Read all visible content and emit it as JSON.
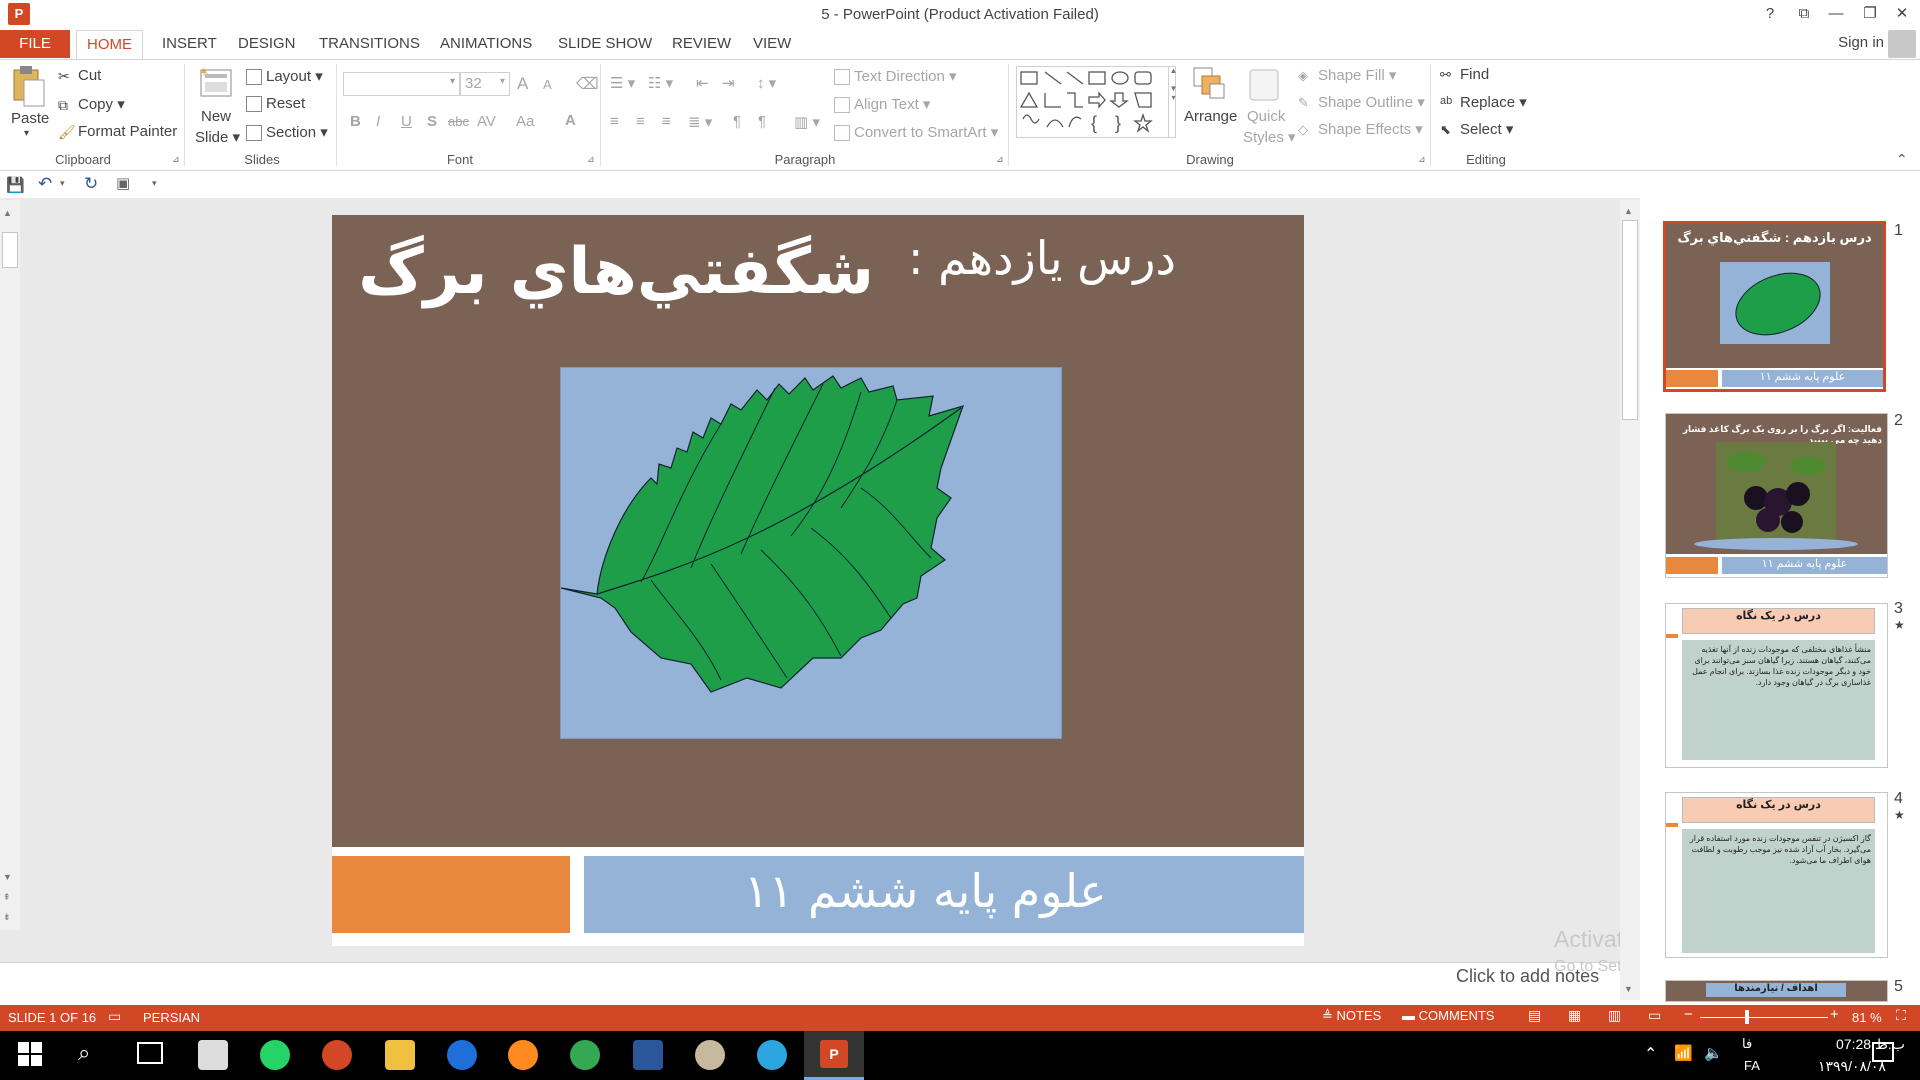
{
  "window": {
    "title": "5 - PowerPoint (Product Activation Failed)",
    "help": "?",
    "restore_ribbon": "⧉",
    "minimize": "—",
    "maximize": "❐",
    "close": "✕"
  },
  "tabs": {
    "file": "FILE",
    "home": "HOME",
    "insert": "INSERT",
    "design": "DESIGN",
    "transitions": "TRANSITIONS",
    "animations": "ANIMATIONS",
    "slideshow": "SLIDE SHOW",
    "review": "REVIEW",
    "view": "VIEW",
    "signin": "Sign in"
  },
  "ribbon": {
    "clipboard": {
      "label": "Clipboard",
      "paste": "Paste",
      "cut": "Cut",
      "copy": "Copy",
      "format_painter": "Format Painter"
    },
    "slides": {
      "label": "Slides",
      "new_slide": "New",
      "new_slide2": "Slide",
      "layout": "Layout",
      "reset": "Reset",
      "section": "Section"
    },
    "font": {
      "label": "Font",
      "size": "32",
      "bold": "B",
      "italic": "I",
      "underline": "U",
      "shadow": "S",
      "strike": "abc",
      "spacing": "AV",
      "case": "Aa",
      "color": "A",
      "grow": "A",
      "shrink": "A"
    },
    "paragraph": {
      "label": "Paragraph",
      "text_direction": "Text Direction",
      "align_text": "Align Text",
      "smartart": "Convert to SmartArt"
    },
    "drawing": {
      "label": "Drawing",
      "arrange": "Arrange",
      "quick_styles": "Quick",
      "quick_styles2": "Styles",
      "shape_fill": "Shape Fill",
      "shape_outline": "Shape Outline",
      "shape_effects": "Shape Effects"
    },
    "editing": {
      "label": "Editing",
      "find": "Find",
      "replace": "Replace",
      "select": "Select"
    }
  },
  "slide": {
    "title_main": "شگفتي‌هاي برگ",
    "title_lesson": "درس يازدهم :",
    "footer_text": "علوم پايه ششم     ۱۱"
  },
  "notes": {
    "placeholder": "Click to add notes"
  },
  "watermark": {
    "line1": "Activate Windows",
    "line2": "Go to Settings to activate Windows."
  },
  "thumbnails": [
    {
      "num": "1",
      "title": "درس يازدهم : شگفتي‌هاي برگ",
      "footer": "علوم پايه ششم ۱۱"
    },
    {
      "num": "2",
      "title": "فعالیت: اگر برگ را بر روی یک برگ کاغذ فشار دهید چه می بینید",
      "footer": "علوم پايه ششم ۱۱"
    },
    {
      "num": "3",
      "title": "درس در یک نگاه",
      "star": "★",
      "body": "منشأ غذاهای مختلفی که موجودات زنده از آنها تغذیه می‌کنند، گیاهان هستند. زیرا گیاهان سبز می‌توانند برای خود و دیگر موجودات زنده غذا بسازند. برای انجام عمل غذاسازی برگ در گیاهان وجود دارد."
    },
    {
      "num": "4",
      "title": "درس در یک نگاه",
      "star": "★",
      "body": "گاز اکسیژن در تنفس موجودات زنده مورد استفاده قرار می‌گیرد. بخار آب آزاد شده نیز موجب رطوبت و لطافت هوای اطراف ما می‌شود."
    },
    {
      "num": "5",
      "title": "اهداف / نیازمندها"
    }
  ],
  "statusbar": {
    "slide_info": "SLIDE 1 OF 16",
    "language": "PERSIAN",
    "notes": "NOTES",
    "comments": "COMMENTS",
    "zoom": "81 %",
    "zoom_minus": "−",
    "zoom_plus": "+"
  },
  "taskbar": {
    "time": "07:28 ب.ظ",
    "date": "۱۳۹۹/۰۸/۰۸",
    "lang": "FA",
    "lang2": "فا"
  },
  "colors": {
    "accent": "#d24726",
    "slide_bg": "#7a6255",
    "leaf_bg": "#95b3d7",
    "leaf": "#1f9e4a",
    "orange": "#e8883f"
  }
}
